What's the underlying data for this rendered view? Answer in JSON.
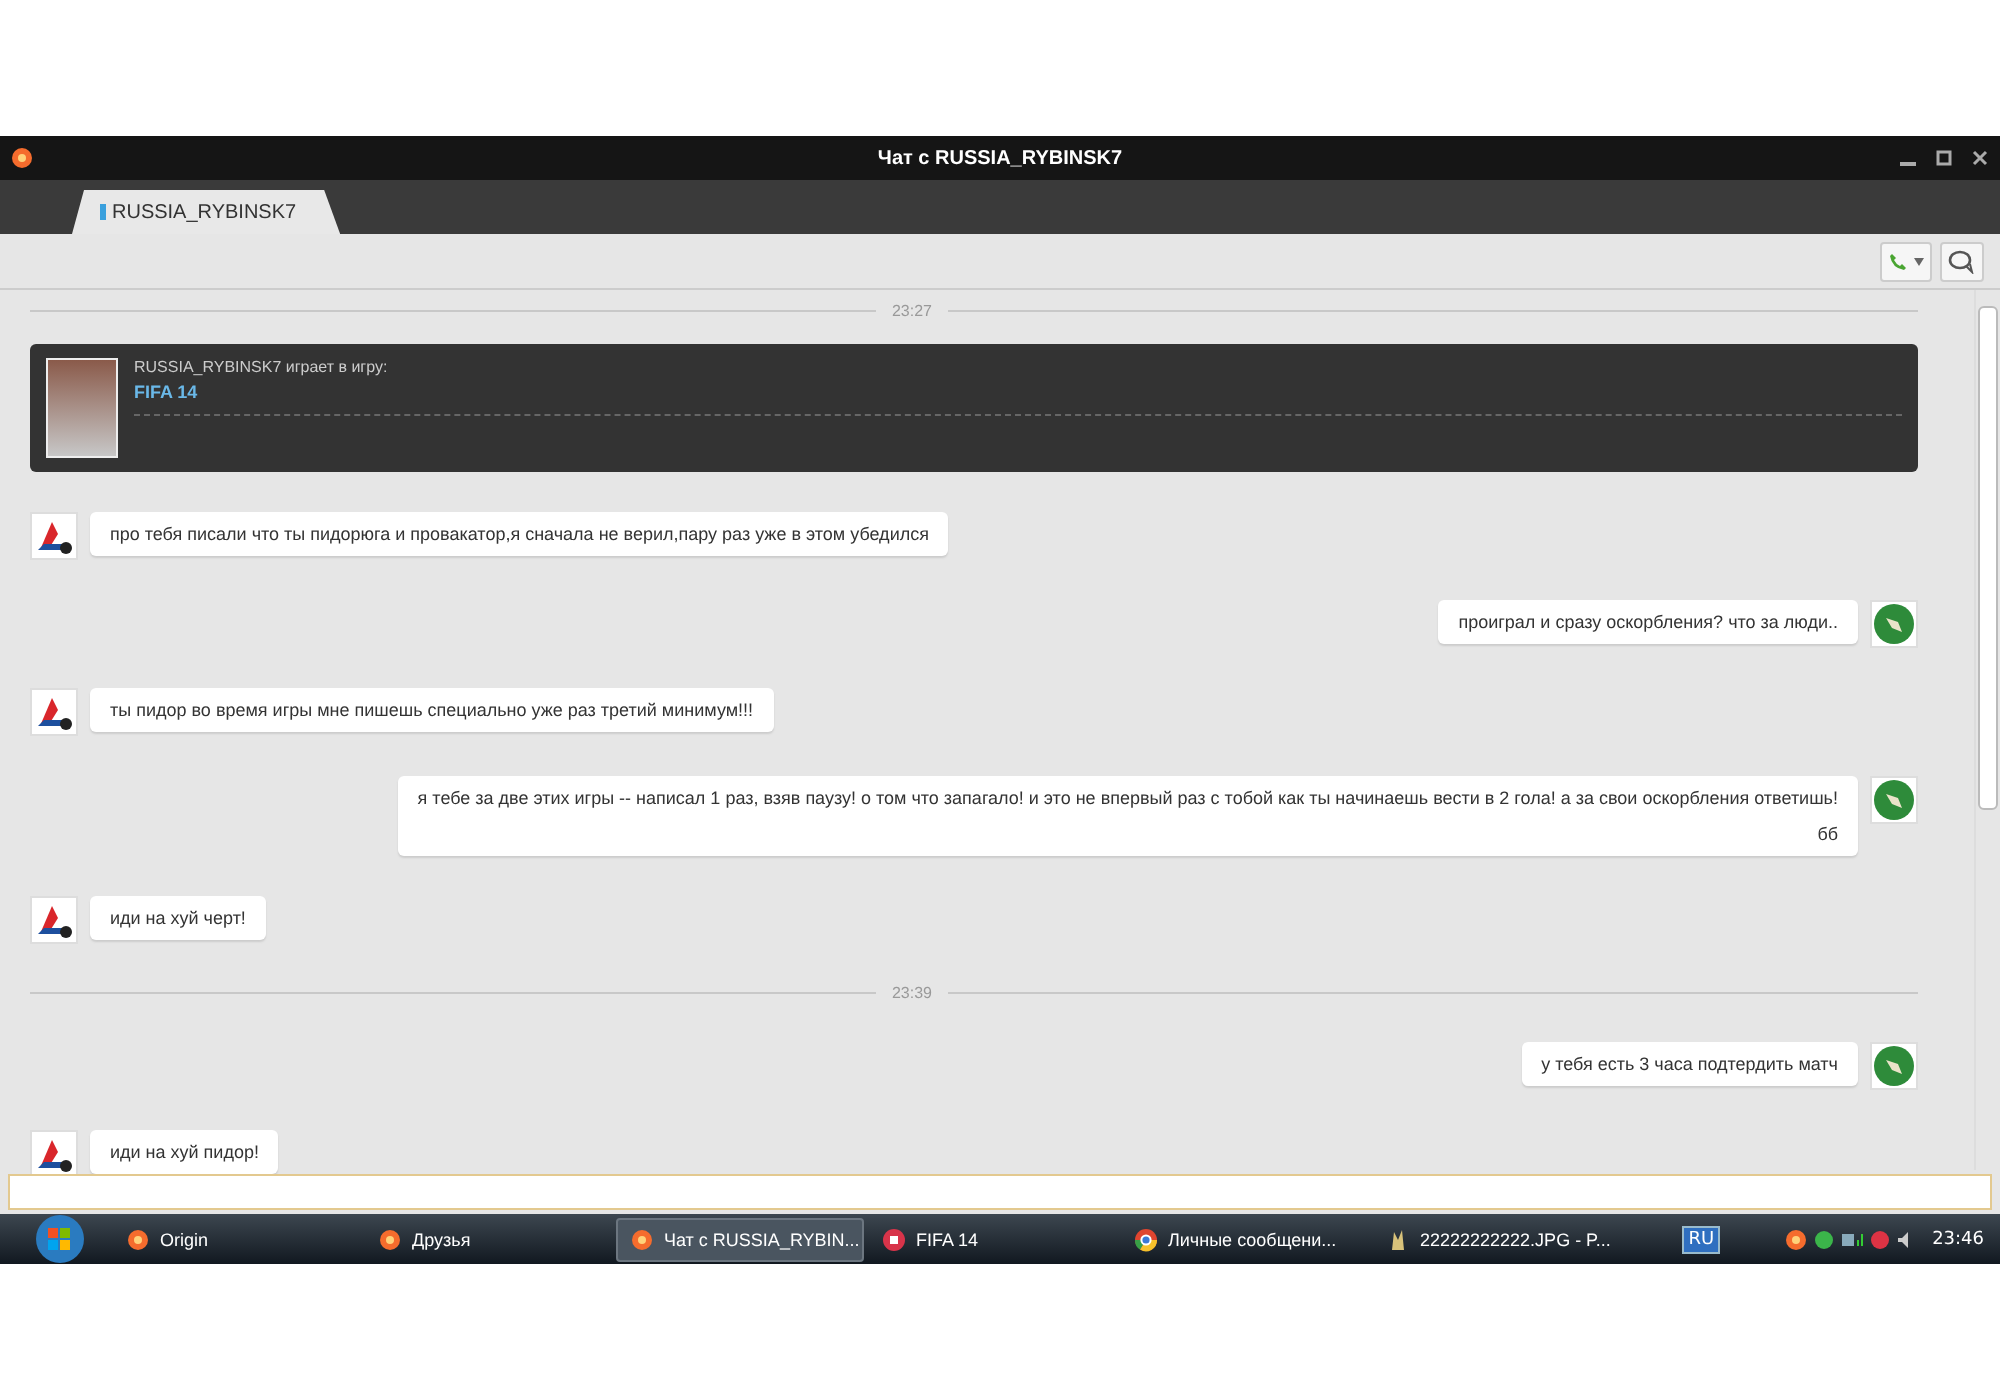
{
  "window": {
    "title": "Чат с RUSSIA_RYBINSK7"
  },
  "tabs": [
    {
      "label": "RUSSIA_RYBINSK7",
      "selected": true
    }
  ],
  "messages": [
    {
      "kind": "time",
      "text": "23:27"
    },
    {
      "kind": "game",
      "text": "RUSSIA_RYBINSK7 играет в игру:",
      "game": "FIFA 14"
    },
    {
      "kind": "incoming",
      "text": "про тебя писали что ты пидорюга и провакатор,я сначала не верил,пару раз уже в этом убедился"
    },
    {
      "kind": "outgoing",
      "text": "проиграл и сразу оскорбления? что за люди.."
    },
    {
      "kind": "incoming",
      "text": "ты пидор во время игры мне пишешь специально уже раз третий минимум!!!"
    },
    {
      "kind": "outgoing",
      "text": "я тебе за две этих игры -- написал 1 раз, взяв паузу! о том что запагало! и это не впервый раз с тобой как ты начинаешь вести в 2 гола! а за свои оскорбления ответишь!",
      "extra": "бб"
    },
    {
      "kind": "incoming",
      "text": "иди на хуй черт!"
    },
    {
      "kind": "time",
      "text": "23:39"
    },
    {
      "kind": "outgoing",
      "text": "у тебя есть 3 часа подтердить матч"
    },
    {
      "kind": "incoming",
      "text": "иди на хуй пидор!"
    }
  ],
  "taskbar": {
    "items": [
      {
        "label": "Origin",
        "selected": false
      },
      {
        "label": "Друзья",
        "selected": false
      },
      {
        "label": "Чат с RUSSIA_RYBIN...",
        "selected": true
      },
      {
        "label": "FIFA 14",
        "selected": false
      },
      {
        "label": "Личные сообщени...",
        "selected": false
      },
      {
        "label": "22222222222.JPG - P...",
        "selected": false
      }
    ],
    "language": "RU",
    "clock": "23:46"
  }
}
